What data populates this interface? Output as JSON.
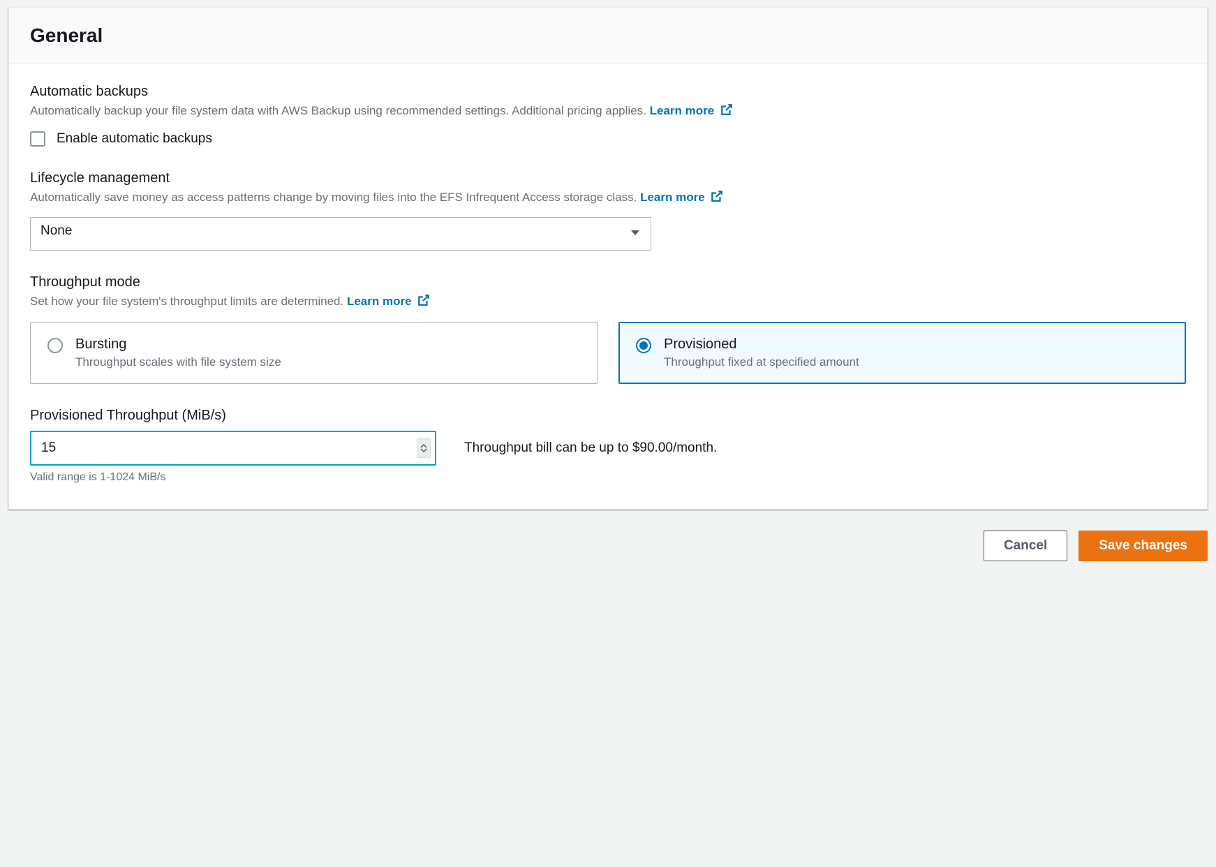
{
  "panel": {
    "title": "General"
  },
  "backups": {
    "title": "Automatic backups",
    "desc": "Automatically backup your file system data with AWS Backup using recommended settings. Additional pricing applies.",
    "learn_more": "Learn more",
    "checkbox_label": "Enable automatic backups"
  },
  "lifecycle": {
    "title": "Lifecycle management",
    "desc": "Automatically save money as access patterns change by moving files into the EFS Infrequent Access storage class.",
    "learn_more": "Learn more",
    "selected": "None"
  },
  "throughput_mode": {
    "title": "Throughput mode",
    "desc": "Set how your file system's throughput limits are determined.",
    "learn_more": "Learn more",
    "options": [
      {
        "title": "Bursting",
        "desc": "Throughput scales with file system size"
      },
      {
        "title": "Provisioned",
        "desc": "Throughput fixed at specified amount"
      }
    ]
  },
  "provisioned": {
    "title": "Provisioned Throughput (MiB/s)",
    "value": "15",
    "bill": "Throughput bill can be up to $90.00/month.",
    "hint": "Valid range is 1-1024 MiB/s"
  },
  "actions": {
    "cancel": "Cancel",
    "save": "Save changes"
  }
}
